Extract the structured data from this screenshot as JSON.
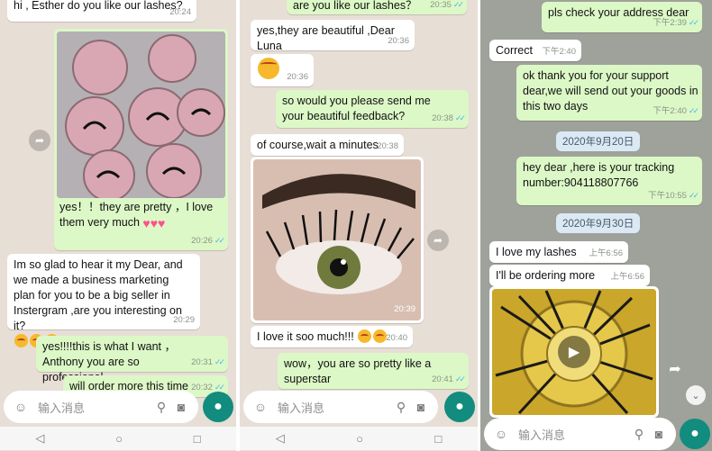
{
  "panel1": {
    "messages": [
      {
        "text": "hi , Esther do you like our lashes?",
        "time": "20:24"
      },
      {
        "caption": "yes！！they are pretty ，I love them very much",
        "time": "20:26",
        "ticks": "✓✓"
      },
      {
        "text": "Im so glad to hear it my Dear, and we made a business marketing plan for you to be a big seller in Instergram ,are you interesting on it?",
        "time": "20:29"
      },
      {
        "text": "yes!!!!this is what I want ，Anthony you are so professional",
        "time": "20:31",
        "ticks": "✓✓"
      },
      {
        "text": "will order more this time",
        "time": "20:32",
        "ticks": "✓✓"
      }
    ],
    "composer": {
      "placeholder": "输入消息"
    }
  },
  "panel2": {
    "messages": [
      {
        "text": "are you like our lashes？",
        "time": "20:35",
        "ticks": "✓✓"
      },
      {
        "text": "yes,they are beautiful ,Dear Luna",
        "time": "20:36"
      },
      {
        "text": "",
        "time": "20:36"
      },
      {
        "text": "so would you please send me your beautiful feedback?",
        "time": "20:38",
        "ticks": "✓✓"
      },
      {
        "text": "of course,wait a minutes",
        "time": "20:38"
      },
      {
        "photo_time": "20:39"
      },
      {
        "text": "I love it soo much!!!",
        "time": "20:40"
      },
      {
        "text": "wow，you are so pretty like a superstar",
        "time": "20:41",
        "ticks": "✓✓"
      }
    ],
    "composer": {
      "placeholder": "输入消息"
    }
  },
  "panel3": {
    "messages": [
      {
        "text": "pls check your address dear",
        "time": "下午2:39",
        "ticks": "✓✓"
      },
      {
        "text": "Correct",
        "time": "下午2:40"
      },
      {
        "text": "ok thank you for your support dear,we will send out your goods in this two days",
        "time": "下午2:40",
        "ticks": "✓✓"
      },
      {
        "date": "2020年9月20日"
      },
      {
        "text": "hey dear ,here is your tracking number:904118807766",
        "time": "下午10:55",
        "ticks": "✓✓"
      },
      {
        "date": "2020年9月30日"
      },
      {
        "text": "I love my lashes",
        "time": "上午6:56"
      },
      {
        "text": "I'll be ordering more",
        "time": "上午6:56"
      }
    ],
    "composer": {
      "placeholder": "输入消息"
    }
  },
  "colors": {
    "outgoing": "#dcf8c6",
    "incoming": "#ffffff",
    "accent": "#128c7e",
    "ticks": "#4fb6ec"
  },
  "icons": [
    "emoji-icon",
    "attach-icon",
    "camera-icon",
    "mic-icon",
    "back-nav-icon",
    "home-nav-icon",
    "recents-nav-icon",
    "forward-icon",
    "scroll-down-icon",
    "play-icon"
  ]
}
